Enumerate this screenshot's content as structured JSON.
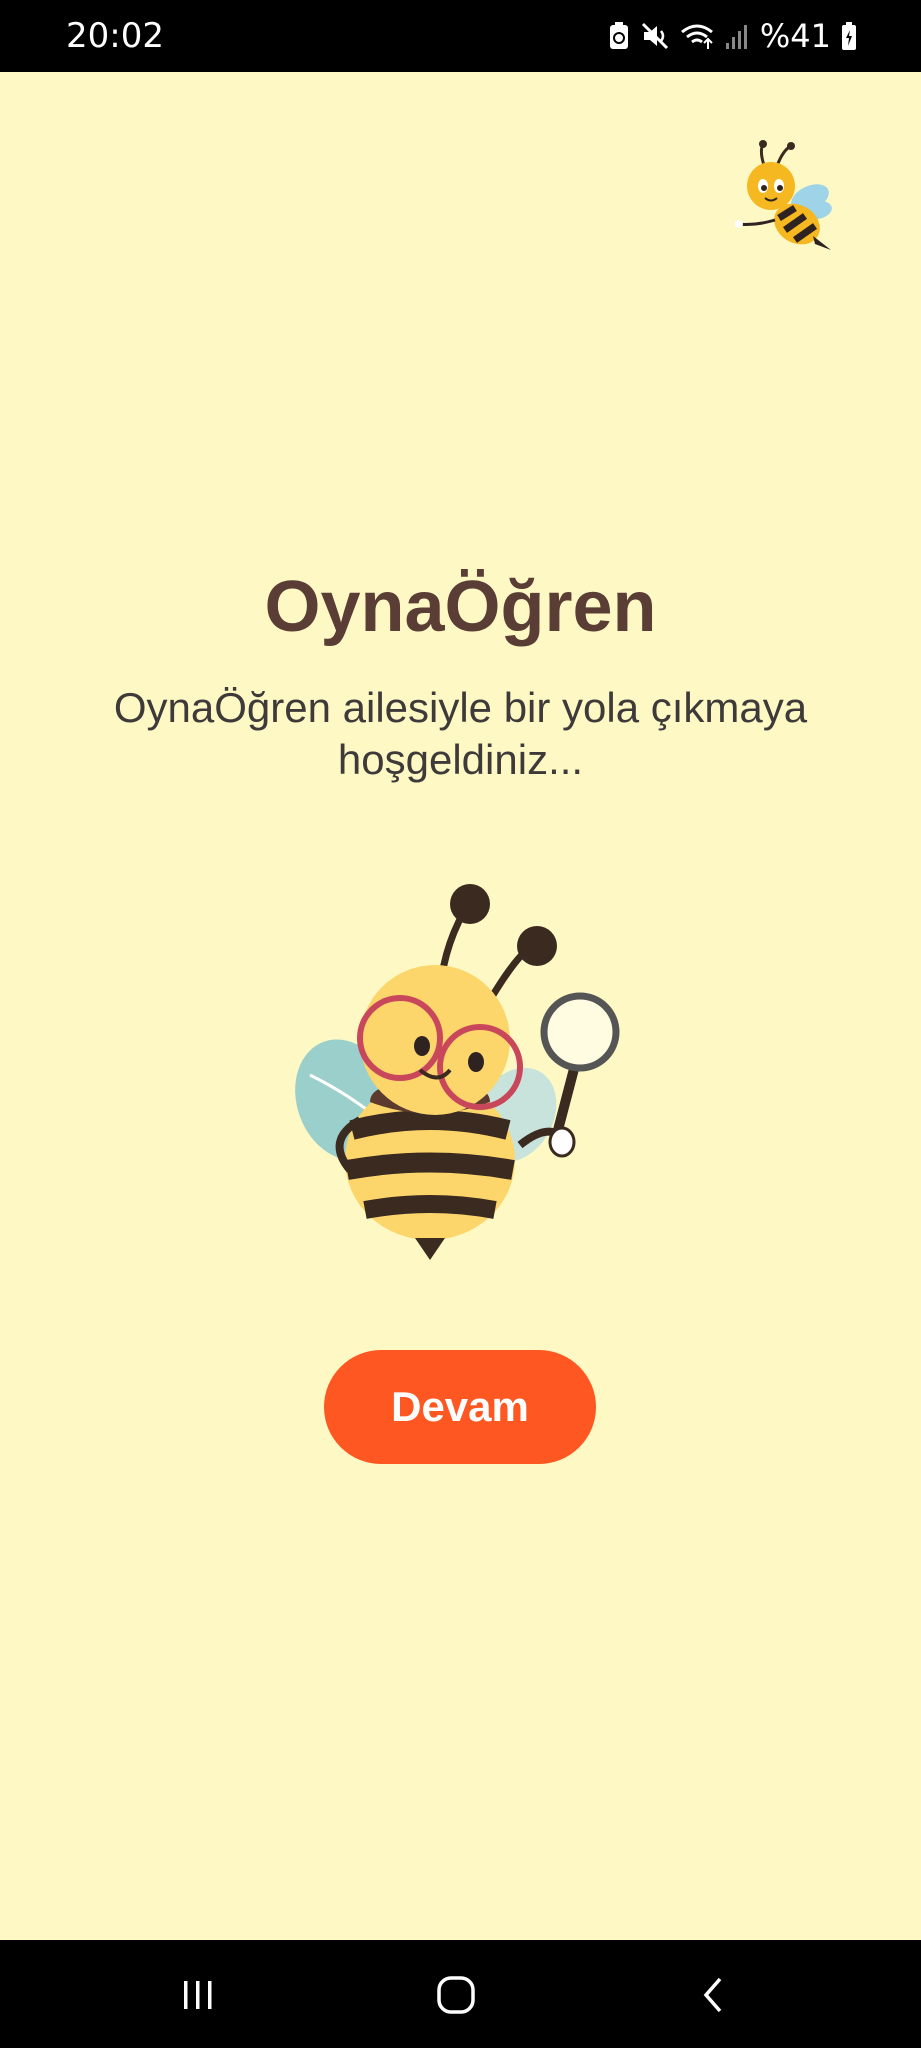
{
  "status_bar": {
    "time": "20:02",
    "battery": "%41",
    "icons": [
      "battery-saver-icon",
      "mute-icon",
      "wifi-icon",
      "signal-icon",
      "battery-icon"
    ]
  },
  "main": {
    "title": "OynaÖğren",
    "subtitle": "OynaÖğren ailesiyle bir yola çıkmaya hoşgeldiniz...",
    "continue_label": "Devam"
  },
  "nav_bar": {
    "icons": [
      "recents-icon",
      "home-icon",
      "back-icon"
    ]
  },
  "colors": {
    "background": "#FEF8C5",
    "title": "#5A3E36",
    "subtitle": "#3E3A39",
    "button": "#FF5722",
    "button_text": "#FFFFFF",
    "system_bars": "#000000"
  }
}
